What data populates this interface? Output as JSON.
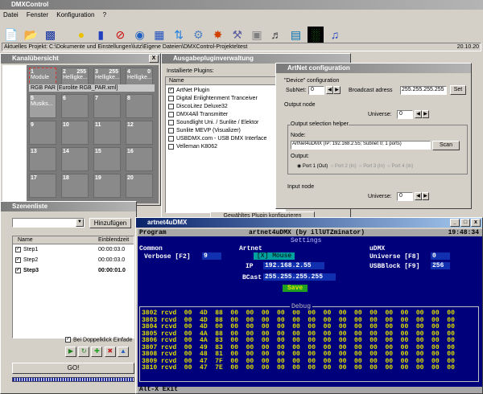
{
  "app": {
    "title": "DMXControl",
    "menu": [
      "Datei",
      "Fenster",
      "Konfiguration",
      "?"
    ],
    "project_label": "Aktuelles Projekt: C:\\Dokumente und Einstellungen\\lutz\\Eigene Dateien\\DMXControl-Projekte\\test",
    "date": "20.10.20",
    "icons": [
      "new-icon",
      "open-icon",
      "save-icon",
      "bulb-icon",
      "channel-icon",
      "no-sound-icon",
      "eye-icon",
      "grid-icon",
      "arrows-icon",
      "settings-icon",
      "effect-icon",
      "tool-icon",
      "cube-icon",
      "speaker-icon",
      "book-icon",
      "equalizer-icon",
      "music-icon"
    ]
  },
  "kanal": {
    "title": "Kanalübersicht",
    "close": "X",
    "cells": [
      {
        "n": "1",
        "label": "Module"
      },
      {
        "n": "2",
        "label": "Helligke..."
      },
      {
        "n": "3",
        "label": "Helligke..."
      },
      {
        "n": "4",
        "label": "Helligke..."
      },
      {
        "n": "5",
        "label": "Musiks..."
      },
      {
        "n": "6",
        "label": ""
      },
      {
        "n": "7",
        "label": ""
      },
      {
        "n": "8",
        "label": ""
      },
      {
        "n": "9",
        "label": ""
      },
      {
        "n": "10",
        "label": ""
      },
      {
        "n": "11",
        "label": ""
      },
      {
        "n": "12",
        "label": ""
      },
      {
        "n": "13",
        "label": ""
      },
      {
        "n": "14",
        "label": ""
      },
      {
        "n": "15",
        "label": ""
      },
      {
        "n": "16",
        "label": ""
      },
      {
        "n": "17",
        "label": ""
      },
      {
        "n": "18",
        "label": ""
      },
      {
        "n": "19",
        "label": ""
      },
      {
        "n": "20",
        "label": ""
      }
    ],
    "row_values": [
      "255",
      "255",
      "0"
    ],
    "device_label": "RGB PAR [Eurolite RGB_PAR.xml]"
  },
  "szenen": {
    "title": "Szenenliste",
    "add_button": "Hinzufügen",
    "col_name": "Name",
    "col_time": "Einblendzeit",
    "rows": [
      {
        "name": "Step1",
        "time": "00:00:03.0"
      },
      {
        "name": "Step2",
        "time": "00:00:03.0"
      },
      {
        "name": "Step3",
        "time": "00:00:01.0"
      }
    ],
    "doubleclick_label": "Bei Doppelklick Einfade",
    "go": "GO!"
  },
  "ausgabe": {
    "title": "Ausgabepluginverwaltung",
    "installed": "Installierte Plugins:",
    "col_name": "Name",
    "plugins": [
      {
        "name": "ArtNet Plugin",
        "checked": true
      },
      {
        "name": "Digital Enlightenment Tranceiver",
        "checked": false
      },
      {
        "name": "DiscoLitez Deluxe32",
        "checked": false
      },
      {
        "name": "DMX4All Transmitter",
        "checked": false
      },
      {
        "name": "Soundlight Uni. / Sunlite / Elektor",
        "checked": false
      },
      {
        "name": "Sunlite MEVP (Visualizer)",
        "checked": false
      },
      {
        "name": "USBDMX.com - USB DMX Interface",
        "checked": false
      },
      {
        "name": "Velleman K8062",
        "checked": false
      }
    ],
    "configure_button": "Gewähltes Plugin konfigurieren"
  },
  "artnet": {
    "title": "ArtNet configuration",
    "device_group": "\"Device\" configuration",
    "subnet_label": "SubNet:",
    "subnet_value": "0",
    "broadcast_label": "Broadcast adress",
    "broadcast_value": "255.255.255.255",
    "set": "Set",
    "output_group": "Output node",
    "universe_label": "Universe:",
    "output_universe": "0",
    "helper_group": "Output selection helper",
    "node_label": "Node:",
    "node_value": "ArtNet4uDMX (IP: 192.168.2.55; Subnet 0; 1 ports)",
    "scan": "Scan",
    "output_label": "Output:",
    "ports": [
      "Port 1 (Out)",
      "Port 2 (In)",
      "Port 3 (In)",
      "Port 4 (In)"
    ],
    "input_group": "Input node",
    "input_universe": "0"
  },
  "term": {
    "title": "artnet4uDMX",
    "header_left": "Program",
    "header_mid": "artnet4uDMX (by illUTZminator)",
    "header_time": "19:48:34",
    "settings": "Settings",
    "common": "Common",
    "artnet": "Artnet",
    "udmx": "uDMX",
    "verbose_label": "Verbose [F2]",
    "verbose_value": "9",
    "mode_value": "[X] Mouse",
    "universe_label": "Universe [F8]",
    "universe_value": "0",
    "ip_label": "IP",
    "ip_value": "192.168.2.55",
    "usbblock_label": "USBBlock [F9]",
    "usbblock_value": "256",
    "bcast_label": "BCast",
    "bcast_value": "255.255.255.255",
    "save": "Save",
    "debug": "Debug",
    "rows": [
      "3802 rcvd  00  4D  88  00  00  00  00  00  00  00  00  00  00  00  00  00  00  00",
      "3803 rcvd  00  4D  88  00  00  00  00  00  00  00  00  00  00  00  00  00  00  00",
      "3804 rcvd  00  4D  00  00  00  00  00  00  00  00  00  00  00  00  00  00  00  00",
      "3805 rcvd  00  4A  88  00  00  00  00  00  00  00  00  00  00  00  00  00  00  00",
      "3806 rcvd  00  4A  83  00  00  00  00  00  00  00  00  00  00  00  00  00  00  00",
      "3807 rcvd  00  49  83  00  00  00  00  00  00  00  00  00  00  00  00  00  00  00",
      "3808 rcvd  00  48  81  00  00  00  00  00  00  00  00  00  00  00  00  00  00  00",
      "3809 rcvd  00  47  7F  00  00  00  00  00  00  00  00  00  00  00  00  00  00  00",
      "3810 rcvd  00  47  7E  00  00  00  00  00  00  00  00  00  00  00  00  00  00  00"
    ],
    "footer": "Alt-X Exit"
  }
}
